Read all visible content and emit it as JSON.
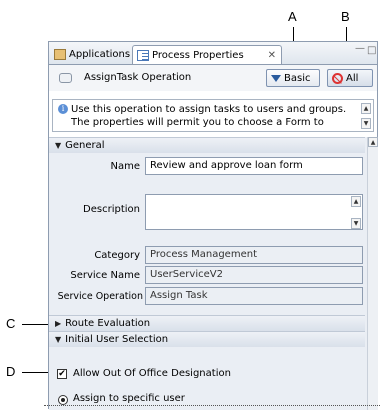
{
  "callouts": {
    "a": "A",
    "b": "B",
    "c": "C",
    "d": "D"
  },
  "tabs": [
    {
      "label": "Applications",
      "icon": "applications-icon"
    },
    {
      "label": "Process Properties",
      "icon": "properties-icon",
      "close": "✕"
    }
  ],
  "window_controls": {
    "minimize": "—",
    "maximize": "□"
  },
  "header": {
    "title": "AssignTask Operation",
    "basic_label": "Basic",
    "all_label": "All"
  },
  "info": {
    "line1": "Use this operation to assign tasks to users and groups.",
    "line2": "The properties will permit you to choose a Form to"
  },
  "sections": {
    "general": "General",
    "route_evaluation": "Route Evaluation",
    "initial_user_selection": "Initial User Selection"
  },
  "form": {
    "name_label": "Name",
    "name_value": "Review and approve loan form",
    "description_label": "Description",
    "description_value": "",
    "category_label": "Category",
    "category_value": "Process Management",
    "service_name_label": "Service Name",
    "service_name_value": "UserServiceV2",
    "service_operation_label": "Service Operation",
    "service_operation_value": "Assign Task"
  },
  "initial_user_selection": {
    "allow_out_of_office_label": "Allow Out Of Office Designation",
    "allow_out_of_office_checked": true,
    "assign_specific_user_label": "Assign to specific user",
    "assign_specific_user_selected": true
  },
  "icons": {
    "collapsed": "▶",
    "expanded": "▼",
    "check": "✔",
    "up": "▲",
    "down": "▼",
    "info": "i"
  }
}
